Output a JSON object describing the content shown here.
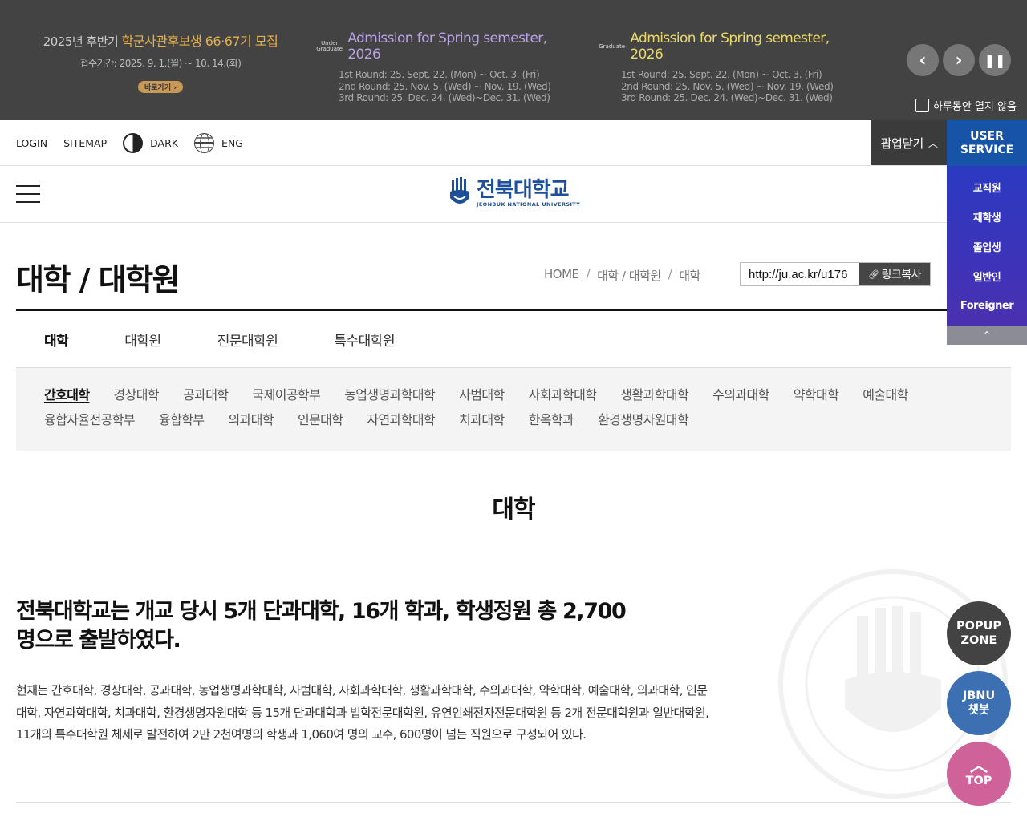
{
  "popup": {
    "slide1": {
      "prefix": "2025년 후반기",
      "highlight": "학군사관후보생 66·67기 모집",
      "period": "접수기간: 2025. 9. 1.(월) ~ 10. 14.(화)",
      "goto_label": "바로가기"
    },
    "slide2": {
      "tag": "Under Graduate",
      "title": "Admission for Spring semester, 2026",
      "rounds": [
        "1st Round: 25. Sept. 22. (Mon) ~ Oct. 3. (Fri)",
        "2nd Round: 25. Nov. 5. (Wed) ~ Nov. 19. (Wed)",
        "3rd Round: 25. Dec. 24. (Wed)~Dec. 31. (Wed)"
      ]
    },
    "slide3": {
      "tag": "Graduate",
      "title": "Admission for Spring semester, 2026",
      "rounds": [
        "1st Round: 25. Sept. 22. (Mon) ~ Oct. 3. (Fri)",
        "2nd Round: 25. Nov. 5. (Wed) ~ Nov. 19. (Wed)",
        "3rd Round: 25. Dec. 24. (Wed)~Dec. 31. (Wed)"
      ]
    },
    "controls": {
      "prev": "‹",
      "next": "›",
      "pause": "❚❚"
    },
    "no_show_today": "하루동안 열지 않음",
    "close_label": "팝업닫기"
  },
  "util": {
    "login": "LOGIN",
    "sitemap": "SITEMAP",
    "dark": "DARK",
    "eng": "ENG"
  },
  "logo": {
    "kr": "전북대학교",
    "en": "JEONBUK NATIONAL UNIVERSITY"
  },
  "quick_menu": {
    "title_line1": "USER",
    "title_line2": "SERVICE",
    "items": [
      "교직원",
      "재학생",
      "졸업생",
      "일반인",
      "Foreigner"
    ],
    "up": "⌃"
  },
  "page": {
    "title": "대학 / 대학원",
    "breadcrumb": [
      "HOME",
      "대학 / 대학원",
      "대학"
    ],
    "breadcrumb_sep": "/",
    "link_url": "http://ju.ac.kr/u176",
    "link_copy": "링크복사"
  },
  "tabs": [
    "대학",
    "대학원",
    "전문대학원",
    "특수대학원"
  ],
  "sub_tabs": [
    "간호대학",
    "경상대학",
    "공과대학",
    "국제이공학부",
    "농업생명과학대학",
    "사범대학",
    "사회과학대학",
    "생활과학대학",
    "수의과대학",
    "약학대학",
    "예술대학",
    "융합자율전공학부",
    "융합학부",
    "의과대학",
    "인문대학",
    "자연과학대학",
    "치과대학",
    "한옥학과",
    "환경생명자원대학"
  ],
  "content": {
    "section_title": "대학",
    "lead": "전북대학교는 개교 당시 5개 단과대학, 16개 학과, 학생정원 총 2,700명으로 출발하였다.",
    "body": "현재는 간호대학, 경상대학, 공과대학, 농업생명과학대학, 사범대학, 사회과학대학, 생활과학대학, 수의과대학, 약학대학, 예술대학, 의과대학, 인문대학, 자연과학대학, 치과대학, 환경생명자원대학 등 15개 단과대학과 법학전문대학원, 유연인쇄전자전문대학원 등 2개 전문대학원과 일반대학원, 11개의 특수대학원 체제로 발전하여 2만 2천여명의 학생과 1,060여 명의 교수, 600명이 넘는 직원으로 구성되어 있다."
  },
  "floating": {
    "popup_zone_1": "POPUP",
    "popup_zone_2": "ZONE",
    "chatbot_1": "JBNU",
    "chatbot_2": "챗봇",
    "top": "TOP"
  },
  "colors": {
    "popup_bg": "#434343",
    "brand_blue": "#1d4f9a",
    "quick_head": "#1753a6",
    "top_btn": "#d0629a"
  }
}
